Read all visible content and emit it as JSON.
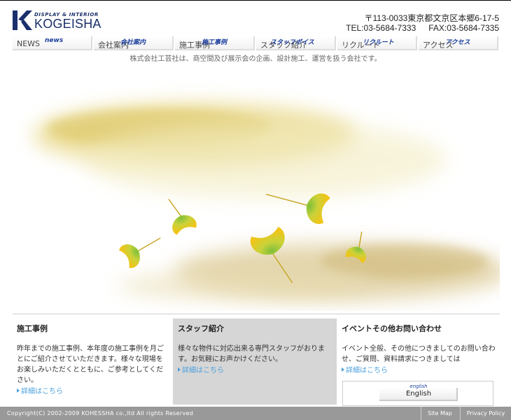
{
  "header": {
    "logo_tagline": "DISPLAY & INTERIOR",
    "logo_name": "KOGEISHA",
    "address": "〒113-0033東京都文京区本郷6-17-5",
    "tel": "TEL:03-5684-7333",
    "fax": "FAX:03-5684-7335"
  },
  "nav": [
    {
      "label": "NEWS",
      "en": "news"
    },
    {
      "label": "会社案内",
      "en": "会社案内"
    },
    {
      "label": "施工事例",
      "en": "施工事例"
    },
    {
      "label": "スタッフ紹介",
      "en": "スタッフボイス"
    },
    {
      "label": "リクルート",
      "en": "リクルート"
    },
    {
      "label": "アクセス",
      "en": "アクセス"
    }
  ],
  "tagline": "株式会社工芸社は、商空間及び展示会の企画、設計施工、運営を扱う会社です。",
  "columns": [
    {
      "title": "施工事例",
      "body": "昨年までの施工事例、本年度の施工事例を月ごとにご紹介させていただきます。様々な現場をお楽しみいただくとともに、ご参考としてください。",
      "more": "詳細はこちら"
    },
    {
      "title": "スタッフ紹介",
      "body": "様々な物件に対応出来る専門スタッフがおります。お気軽にお声かけください。",
      "more": "詳細はこちら"
    },
    {
      "title": "イベントその他お問い合わせ",
      "body": "イベント全般、その他につきましてのお問い合わせ、ご質問、資料請求につきましては",
      "more": "詳細はこちら"
    }
  ],
  "english": {
    "small": "english",
    "label": "English"
  },
  "footer": {
    "copyright": "Copyright(C) 2002-2009 KOHESSHA co.,ltd All rights Reserved",
    "links": [
      "Site Map",
      "Privacy Policy"
    ]
  },
  "colors": {
    "brand": "#1a2f6b",
    "nav_en": "#1c3f9f",
    "link": "#4aa0de",
    "footer_bg": "#999999"
  }
}
